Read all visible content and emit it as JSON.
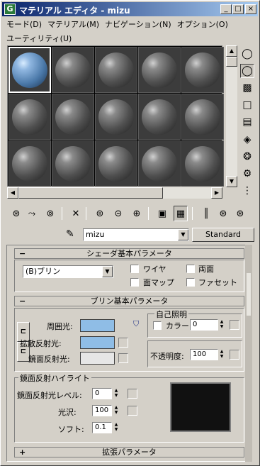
{
  "window": {
    "title": "マテリアル エディタ - mizu",
    "app_icon_letter": "G",
    "minimize": "_",
    "maximize": "□",
    "close": "×"
  },
  "menu": [
    "モード(D)",
    "マテリアル(M)",
    "ナビゲーション(N)",
    "オプション(O)",
    "ユーティリティ(U)"
  ],
  "slots": {
    "rows": 3,
    "cols": 5,
    "selected_index": 0,
    "selected_color": "#5f8fc0",
    "default_color": "#5a5a5a"
  },
  "material_name": {
    "value": "mizu",
    "type_button": "Standard"
  },
  "shader_rollout": {
    "toggle": "−",
    "title": "シェーダ基本パラメータ",
    "shader": "(B)ブリン",
    "options": {
      "wire": "ワイヤ",
      "two_sided": "両面",
      "face_map": "面マップ",
      "faceted": "ファセット"
    }
  },
  "blinn_rollout": {
    "toggle": "−",
    "title": "ブリン基本パラメータ",
    "ambient_label": "周囲光:",
    "diffuse_label": "拡散反射光:",
    "specular_label": "鏡面反射光:",
    "ambient_color": "#8fbde6",
    "diffuse_color": "#8fbde6",
    "specular_color": "#e6e6e6",
    "lock_top": "⊏",
    "lock_bottom": "⊏",
    "self_illum_title": "自己照明",
    "color_label": "カラー",
    "self_illum_value": "0",
    "opacity_label": "不透明度:",
    "opacity_value": "100",
    "spec_highlight_title": "鏡面反射ハイライト",
    "spec_level_label": "鏡面反射光レベル:",
    "spec_level_value": "0",
    "gloss_label": "光沢:",
    "gloss_value": "100",
    "soften_label": "ソフト:",
    "soften_value": "0.1"
  },
  "extended_rollout": {
    "toggle": "+",
    "title": "拡張パラメータ"
  }
}
